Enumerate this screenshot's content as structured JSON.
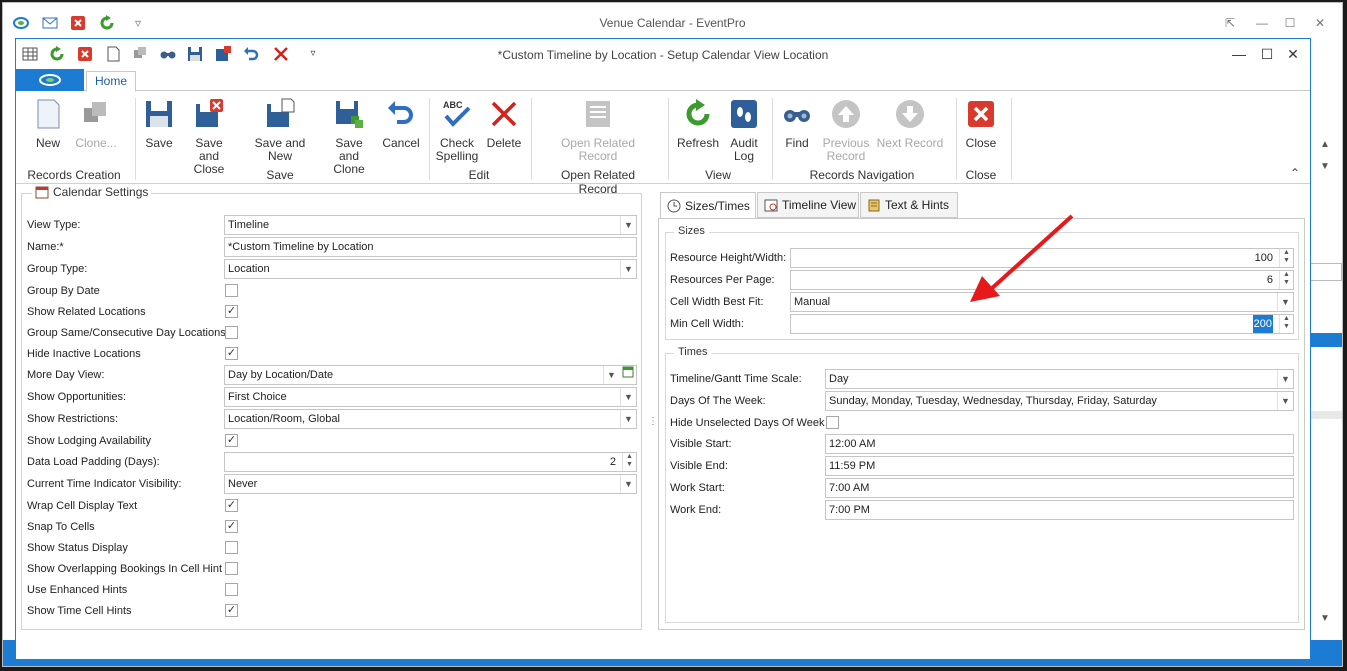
{
  "outer": {
    "title": "Venue Calendar - EventPro"
  },
  "window": {
    "title": "*Custom Timeline by Location - Setup Calendar View Location"
  },
  "tabs": {
    "home": "Home"
  },
  "ribbon": {
    "new": "New",
    "clone": "Clone...",
    "records_creation": "Records Creation",
    "save": "Save",
    "save_close": "Save and Close",
    "save_new": "Save and New",
    "save_clone": "Save and Clone",
    "cancel": "Cancel",
    "save_group": "Save",
    "check_spelling": "Check Spelling",
    "delete": "Delete",
    "edit_group": "Edit",
    "open_related": "Open Related Record",
    "open_related_group": "Open Related Record",
    "refresh": "Refresh",
    "audit_log": "Audit Log",
    "view_group": "View",
    "find": "Find",
    "previous": "Previous Record",
    "next": "Next Record",
    "nav_group": "Records Navigation",
    "close": "Close",
    "close_group": "Close"
  },
  "calendar": {
    "title": "Calendar Settings",
    "view_type_label": "View Type:",
    "view_type": "Timeline",
    "name_label": "Name:*",
    "name": "*Custom Timeline by Location",
    "group_type_label": "Group Type:",
    "group_type": "Location",
    "group_by_date_label": "Group By Date",
    "show_related_label": "Show Related Locations",
    "group_same_label": "Group Same/Consecutive Day Locations",
    "hide_inactive_label": "Hide Inactive Locations",
    "more_day_label": "More Day View:",
    "more_day": "Day by Location/Date",
    "show_opps_label": "Show Opportunities:",
    "show_opps": "First Choice",
    "show_restr_label": "Show Restrictions:",
    "show_restr": "Location/Room, Global",
    "show_lodging_label": "Show Lodging Availability",
    "data_padding_label": "Data Load Padding (Days):",
    "data_padding": "2",
    "time_indicator_label": "Current Time Indicator Visibility:",
    "time_indicator": "Never",
    "wrap_label": "Wrap Cell Display Text",
    "snap_label": "Snap To Cells",
    "status_label": "Show Status Display",
    "overlap_label": "Show Overlapping Bookings In Cell Hint",
    "enhanced_label": "Use Enhanced Hints",
    "time_hints_label": "Show Time Cell Hints",
    "check_mark": "✓"
  },
  "right_tabs": {
    "sizes": "Sizes/Times",
    "timeline": "Timeline View",
    "text": "Text & Hints"
  },
  "sizes": {
    "title": "Sizes",
    "res_hw_label": "Resource Height/Width:",
    "res_hw": "100",
    "res_page_label": "Resources Per Page:",
    "res_page": "6",
    "best_fit_label": "Cell Width Best Fit:",
    "best_fit": "Manual",
    "min_width_label": "Min Cell Width:",
    "min_width": "200"
  },
  "times": {
    "title": "Times",
    "scale_label": "Timeline/Gantt Time Scale:",
    "scale": "Day",
    "days_label": "Days Of The Week:",
    "days": "Sunday, Monday, Tuesday, Wednesday, Thursday, Friday, Saturday",
    "hide_unsel_label": "Hide Unselected Days Of Week",
    "vis_start_label": "Visible Start:",
    "vis_start": "12:00 AM",
    "vis_end_label": "Visible End:",
    "vis_end": "11:59 PM",
    "work_start_label": "Work Start:",
    "work_start": "7:00 AM",
    "work_end_label": "Work End:",
    "work_end": "7:00 PM"
  },
  "colors": {
    "accent": "#1c7bd2",
    "arrow": "#e8191b"
  }
}
